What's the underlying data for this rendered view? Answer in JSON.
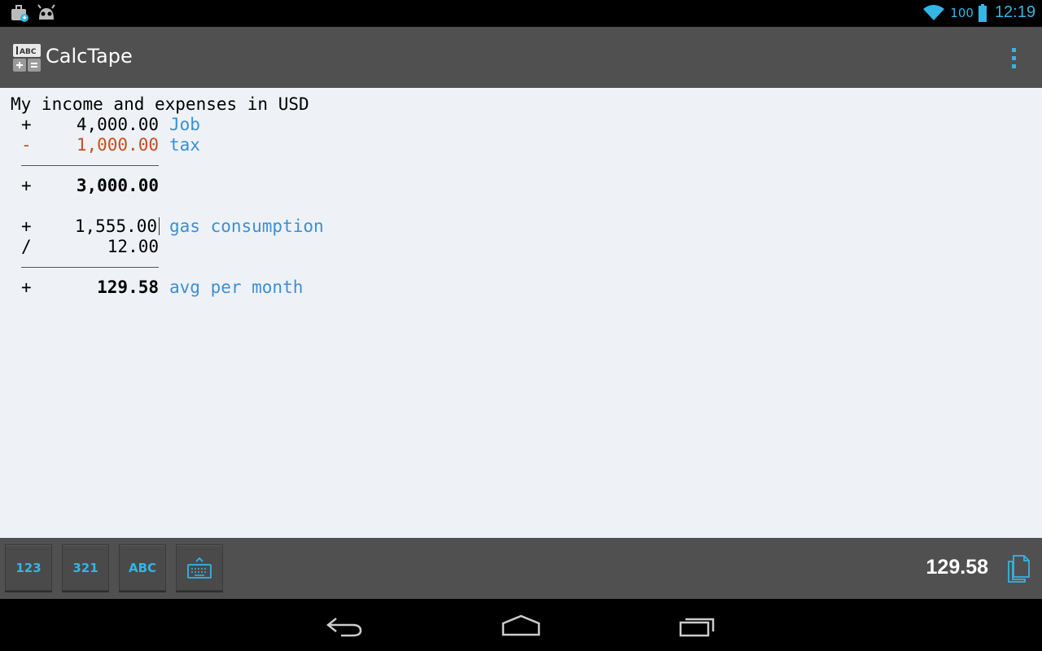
{
  "status_bar": {
    "battery_level": "100",
    "time": "12:19",
    "icons": [
      "briefcase-notification-icon",
      "android-debug-icon",
      "wifi-icon",
      "battery-icon"
    ]
  },
  "action_bar": {
    "title": "CalcTape",
    "icon": "calctape-app-icon",
    "icon_text_top": "ABC",
    "menu_icon": "overflow-menu-icon"
  },
  "tape": {
    "title": "My income and expenses in USD",
    "lines": [
      {
        "op": "+",
        "amount": "4,000.00",
        "comment": "Job"
      },
      {
        "op": "-",
        "amount": "1,000.00",
        "comment": "tax"
      },
      {
        "op": "+",
        "amount": "3,000.00",
        "comment": ""
      },
      {
        "op": "+",
        "amount": "1,555.00",
        "comment": "gas consumption"
      },
      {
        "op": "/",
        "amount": "12.00",
        "comment": ""
      },
      {
        "op": "+",
        "amount": "129.58",
        "comment": "avg per month"
      }
    ]
  },
  "toolbar": {
    "buttons": [
      {
        "label": "123"
      },
      {
        "label": "321"
      },
      {
        "label": "ABC"
      }
    ],
    "keyboard_icon": "keyboard-icon",
    "total": "129.58",
    "copy_icon": "copy-icon"
  },
  "nav_bar": {
    "icons": [
      "back-icon",
      "home-icon",
      "recents-icon"
    ]
  },
  "colors": {
    "accent": "#33b5e5",
    "comment": "#3d8ed6",
    "negative": "#c4501f",
    "tape_bg": "#eef2f6",
    "bar_bg": "#505050"
  }
}
